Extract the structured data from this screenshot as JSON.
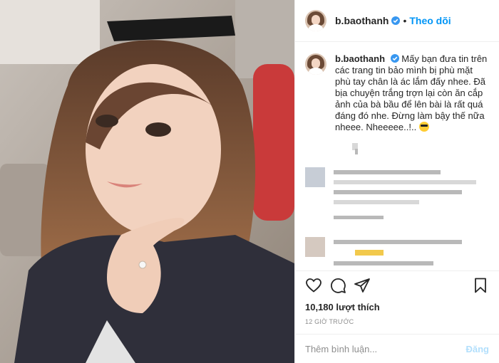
{
  "header": {
    "username": "b.baothanh",
    "separator": "•",
    "follow_label": "Theo dõi"
  },
  "caption": {
    "username": "b.baothanh",
    "text": "Mấy bạn đưa tin trên các trang tin bảo mình bị phù mặt phù tay chân là ác lắm đấy nhee. Đã bịa chuyện trắng trợn lại còn ăn cắp ảnh của bà bầu để lên bài là rất quá đáng đó nhe. Đừng làm bậy thế nữa nheee. Nheeeee..!.."
  },
  "actions": {
    "like_icon": "heart-icon",
    "comment_icon": "comment-icon",
    "share_icon": "paper-plane-icon",
    "save_icon": "bookmark-icon"
  },
  "likes": {
    "text": "10,180 lượt thích"
  },
  "time": {
    "text": "12 GIỜ TRƯỚC"
  },
  "comment_box": {
    "placeholder": "Thêm bình luận...",
    "post_label": "Đăng"
  },
  "colors": {
    "accent": "#0095f6",
    "verified": "#3897f0",
    "post_disabled": "#b2dffc"
  }
}
